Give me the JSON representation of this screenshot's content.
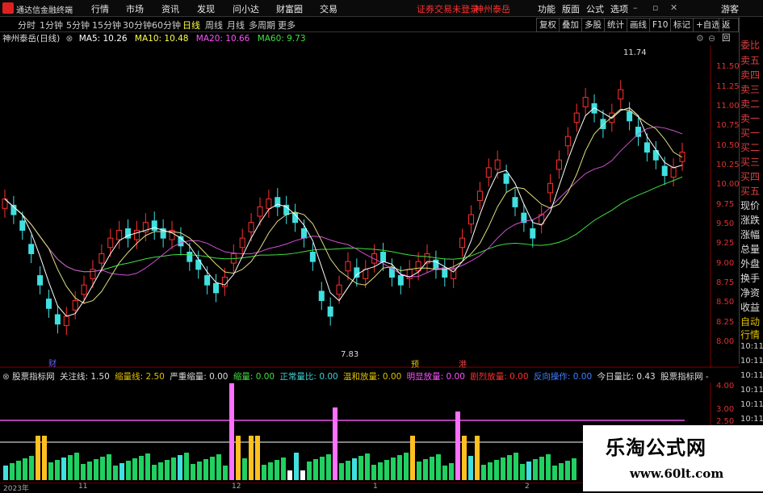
{
  "app": {
    "title": "通达信金融终端"
  },
  "menu": [
    "行情",
    "市场",
    "资讯",
    "发现",
    "问小达",
    "财富圈",
    "交易"
  ],
  "notice": {
    "login": "证券交易未登录",
    "brand": "神州泰岳"
  },
  "top_right": [
    "功能",
    "版面",
    "公式",
    "选项"
  ],
  "guest": "游客",
  "periods": [
    "分时",
    "1分钟",
    "5分钟",
    "15分钟",
    "30分钟",
    "60分钟",
    "日线",
    "周线",
    "月线",
    "多周期",
    "更多"
  ],
  "period_selected": "日线",
  "right_buttons": [
    "复权",
    "叠加",
    "多股",
    "统计",
    "画线",
    "F10",
    "标记",
    "+自选",
    "返回"
  ],
  "ma": {
    "title": "神州泰岳(日线)",
    "ma5": "MA5: 10.26",
    "ma10": "MA10: 10.48",
    "ma20": "MA20: 10.66",
    "ma60": "MA60: 9.73",
    "colors": {
      "ma5": "#ffffff",
      "ma10": "#ffff50",
      "ma20": "#ff50ff",
      "ma60": "#40e040"
    }
  },
  "price_labels": [
    "11.50",
    "11.25",
    "11.00",
    "10.75",
    "10.50",
    "10.25",
    "10.00",
    "9.75",
    "9.50",
    "9.25",
    "9.00",
    "8.75",
    "8.50",
    "8.25",
    "8.00"
  ],
  "annotations": {
    "high": "11.74",
    "low": "7.83",
    "markers": [
      "财",
      "预",
      "港"
    ]
  },
  "right_panel": [
    "委比",
    "卖五",
    "卖四",
    "卖三",
    "卖二",
    "卖一",
    "买一",
    "买二",
    "买三",
    "买四",
    "买五",
    "现价",
    "涨跌",
    "涨幅",
    "总量",
    "外盘",
    "换手",
    "净资",
    "收益",
    "自动",
    "行情",
    "10:11",
    "10:11",
    "10:11",
    "10:11",
    "10:11",
    "10:11"
  ],
  "indicator": {
    "name": "股票指标网",
    "guan": "关注线: 1.50",
    "suo": "缩量线: 2.50",
    "yz": "严重缩量: 0.00",
    "sl": "缩量: 0.00",
    "zc": "正常量比: 0.00",
    "wh": "温和放量: 0.00",
    "mx": "明显放量: 0.00",
    "jl": "剧烈放量: 0.00",
    "fx": "反向操作: 0.00",
    "jr": "今日量比: 0.43",
    "tail": "股票指标网 -"
  },
  "ind_labels": [
    "4.00",
    "3.00",
    "2.50"
  ],
  "date_labels": [
    "2023年",
    "11",
    "12",
    "1",
    "2"
  ],
  "watermark": {
    "line1": "乐淘公式网",
    "line2": "www.60lt.com"
  }
}
